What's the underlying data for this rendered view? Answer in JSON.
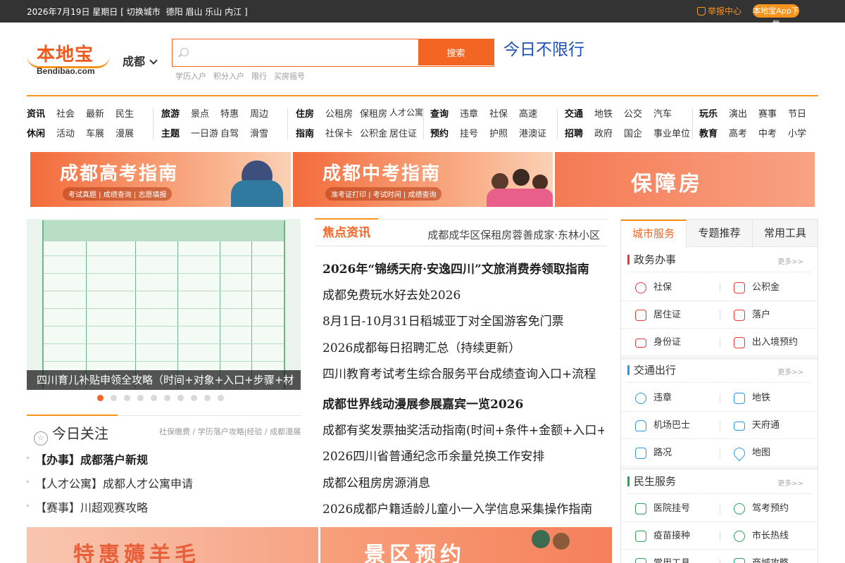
{
  "topbar": {
    "date": "2026年7月19日 星期日",
    "switch_prefix": "[ 切换城市",
    "cities": [
      "德阳",
      "眉山",
      "乐山",
      "内江"
    ],
    "switch_suffix": "]",
    "report": "举报中心",
    "app_download": "本地宝App下载"
  },
  "header": {
    "logo_cn": "本地宝",
    "logo_en": "Bendibao.com",
    "city": "成都",
    "search_button": "搜索",
    "search_placeholder": "",
    "hot_links": [
      "学历入户",
      "积分入户",
      "限行",
      "买房摇号"
    ],
    "slogan": "今日不限行"
  },
  "nav": {
    "groups": [
      {
        "row1": [
          "资讯",
          "社会",
          "最新",
          "民生"
        ],
        "row2": [
          "休闲",
          "活动",
          "车展",
          "漫展"
        ]
      },
      {
        "row1": [
          "旅游",
          "景点",
          "特惠",
          "周边"
        ],
        "row2": [
          "主题",
          "一日游",
          "自驾",
          "滑雪"
        ]
      },
      {
        "row1": [
          "住房",
          "公租房",
          "保租房",
          "人才公寓"
        ],
        "row2": [
          "指南",
          "社保卡",
          "公积金",
          "居住证"
        ]
      },
      {
        "row1": [
          "查询",
          "违章",
          "社保",
          "高速"
        ],
        "row2": [
          "预约",
          "挂号",
          "护照",
          "港澳证"
        ]
      },
      {
        "row1": [
          "交通",
          "地铁",
          "公交",
          "汽车"
        ],
        "row2": [
          "招聘",
          "政府",
          "国企",
          "事业单位"
        ]
      },
      {
        "row1": [
          "玩乐",
          "演出",
          "赛事",
          "节日"
        ],
        "row2": [
          "教育",
          "高考",
          "中考",
          "小学"
        ]
      }
    ]
  },
  "banners": [
    {
      "title": "成都高考指南",
      "sub": "考试真题 | 成绩查询 | 志愿填报"
    },
    {
      "title": "成都中考指南",
      "sub": "准考证打印 | 考试时间 | 成绩查询"
    },
    {
      "title": "保障房",
      "sub": ""
    }
  ],
  "carousel": {
    "caption": "四川育儿补贴申领全攻略（时间+对象+入口+步骤+材",
    "dot_count": 10,
    "active_dot": 1
  },
  "today_focus": {
    "title": "今日关注",
    "links": "社保缴费 / 学历落户攻略|经验 / 成都漫展",
    "items": [
      "【办事】成都落户新规",
      "【人才公寓】成都人才公寓申请",
      "【赛事】川超观赛攻略"
    ]
  },
  "focus_news": {
    "tab": "焦点资讯",
    "tab_right": "成都成华区保租房蓉善成家·东林小区",
    "items": [
      {
        "text": "2026年“锦绣天府·安逸四川”文旅消费券领取指南",
        "bold": true
      },
      {
        "text": "成都免费玩水好去处2026",
        "bold": false
      },
      {
        "text": "8月1日-10月31日稻城亚丁对全国游客免门票",
        "bold": false
      },
      {
        "text": "2026成都每日招聘汇总（持续更新）",
        "bold": false
      },
      {
        "text": "四川教育考试考生综合服务平台成绩查询入口+流程",
        "bold": false
      },
      {
        "text": "成都世界线动漫展参展嘉宾一览2026",
        "bold": true
      },
      {
        "text": "成都有奖发票抽奖活动指南(时间+条件+金额+入口+步",
        "bold": false
      },
      {
        "text": "2026四川省普通纪念币余量兑换工作安排",
        "bold": false
      },
      {
        "text": "成都公租房房源消息",
        "bold": false
      },
      {
        "text": "2026成都户籍适龄儿童小一入学信息采集操作指南",
        "bold": false
      }
    ]
  },
  "sidebar": {
    "tabs": [
      "城市服务",
      "专题推荐",
      "常用工具"
    ],
    "sections": [
      {
        "title": "政务办事",
        "more": "更多>>",
        "items": [
          "社保",
          "公积金",
          "居住证",
          "落户",
          "身份证",
          "出入境预约"
        ]
      },
      {
        "title": "交通出行",
        "more": "更多>>",
        "items": [
          "违章",
          "地铁",
          "机场巴士",
          "天府通",
          "路况",
          "地图"
        ]
      },
      {
        "title": "民生服务",
        "more": "更多>>",
        "items": [
          "医院挂号",
          "驾考预约",
          "疫苗接种",
          "市长热线",
          "常用工具",
          "商城攻略"
        ]
      }
    ]
  },
  "bottom_banners": [
    "特惠薅羊毛",
    "景区预约"
  ],
  "colors": {
    "brand": "#f26522",
    "accent": "#f7941d",
    "slogan": "#1e50b3"
  }
}
